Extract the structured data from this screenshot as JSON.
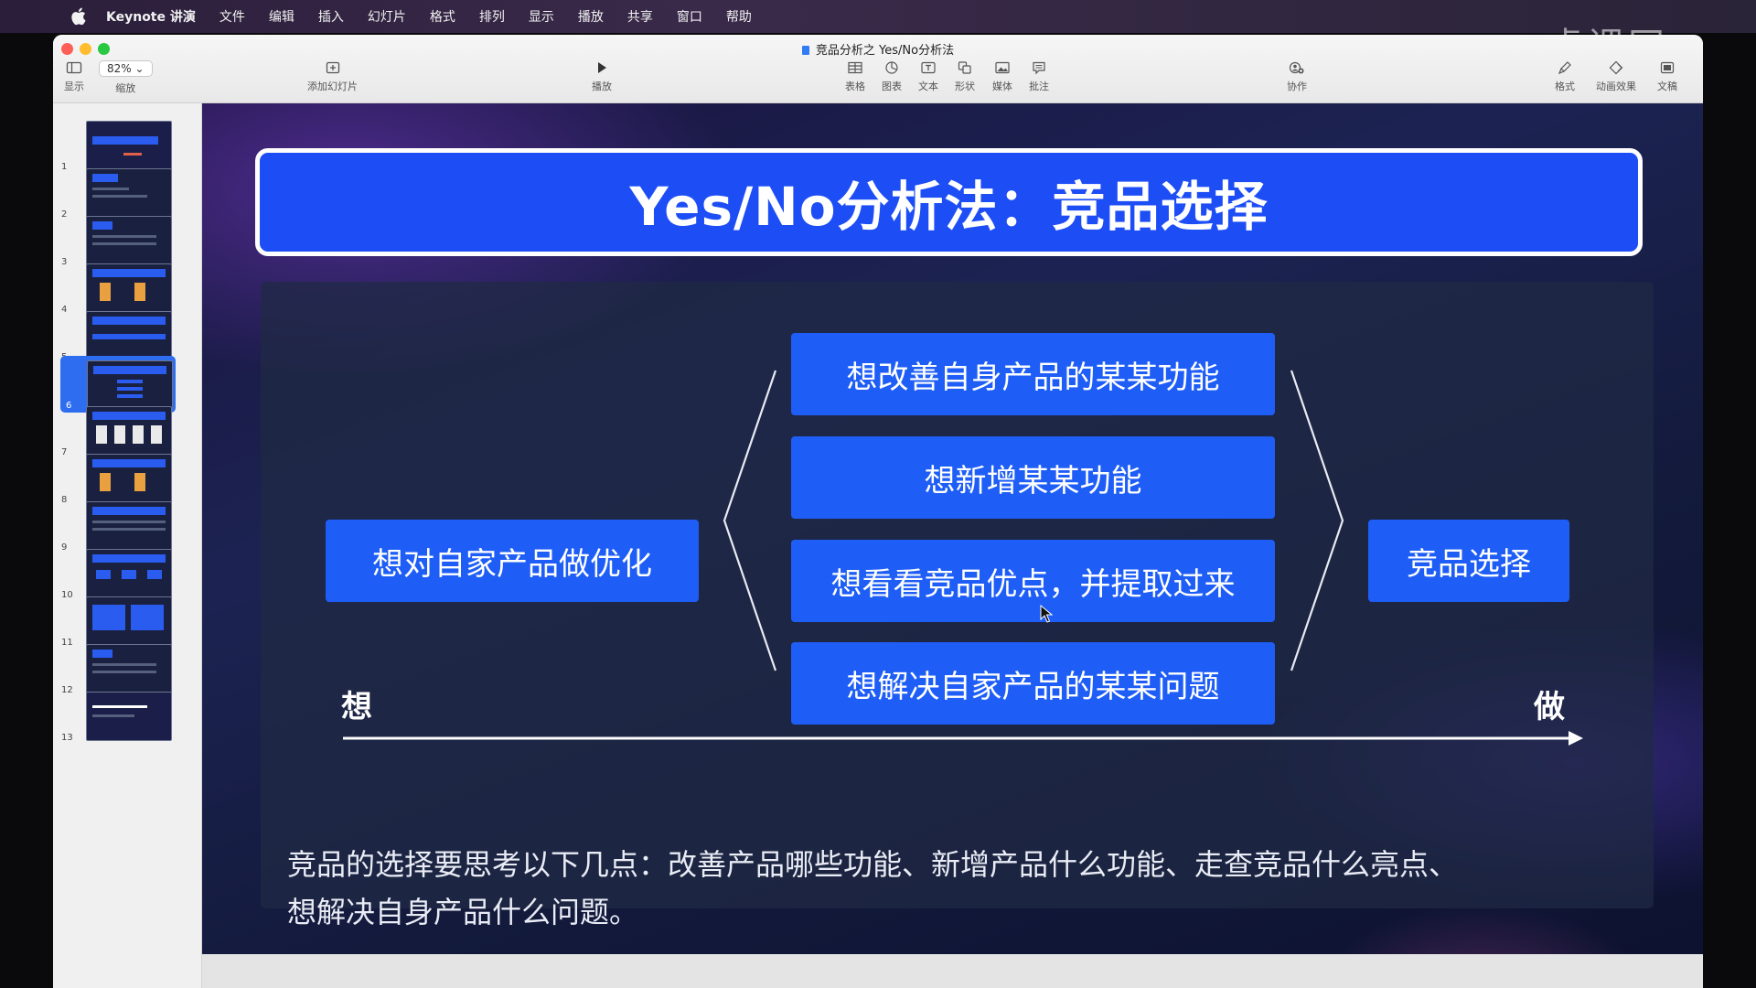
{
  "menubar": {
    "app": "Keynote 讲演",
    "items": [
      "文件",
      "编辑",
      "插入",
      "幻灯片",
      "格式",
      "排列",
      "显示",
      "播放",
      "共享",
      "窗口",
      "帮助"
    ]
  },
  "window": {
    "title": "竞品分析之 Yes/No分析法"
  },
  "toolbar": {
    "view_label": "显示",
    "zoom_value": "82%",
    "zoom_label": "缩放",
    "add_slide_label": "添加幻灯片",
    "play_label": "播放",
    "table_label": "表格",
    "chart_label": "图表",
    "text_label": "文本",
    "shape_label": "形状",
    "media_label": "媒体",
    "comment_label": "批注",
    "collaborate_label": "协作",
    "format_label": "格式",
    "animate_label": "动画效果",
    "document_label": "文稿"
  },
  "navigator": {
    "slides": [
      "1",
      "2",
      "3",
      "4",
      "5",
      "6",
      "7",
      "8",
      "9",
      "10",
      "11",
      "12",
      "13"
    ],
    "active_index": 6
  },
  "slide": {
    "title": "Yes/No分析法：竞品选择",
    "left_box": "想对自家产品做优化",
    "options": [
      "想改善自身产品的某某功能",
      "想新增某某功能",
      "想看看竞品优点，并提取过来",
      "想解决自家产品的某某问题"
    ],
    "right_box": "竞品选择",
    "axis_start": "想",
    "axis_end": "做",
    "summary_line1": "竞品的选择要思考以下几点：改善产品哪些功能、新增产品什么功能、走查竞品什么亮点、",
    "summary_line2": "想解决自身产品什么问题。"
  },
  "watermark": "虎课网",
  "colors": {
    "accent_blue": "#1e5ef6",
    "title_blue": "#1d4ef5",
    "selection_blue": "#2f6df0"
  }
}
